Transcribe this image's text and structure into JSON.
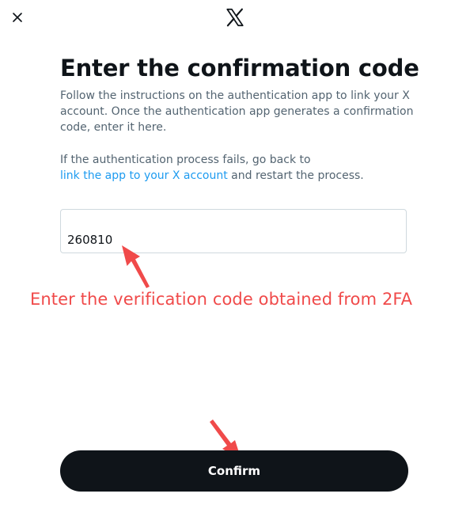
{
  "dialog": {
    "title": "Enter the confirmation code",
    "description": "Follow the instructions on the authentication app to link your X account. Once the authentication app generates a confirmation code, enter it here.",
    "fail_text_before": "If the authentication process fails, go back to",
    "fail_link_text": "link the app to your X account",
    "fail_text_after": "and restart the process.",
    "code_value": "260810",
    "confirm_label": "Confirm"
  },
  "annotations": {
    "code_hint": "Enter the verification code obtained from 2FA"
  },
  "colors": {
    "text_primary": "#0f1419",
    "text_secondary": "#536471",
    "link": "#1d9bf0",
    "annotation": "#f04a4a",
    "button_bg": "#0f1419"
  },
  "icons": {
    "close": "close-icon",
    "logo": "x-logo-icon",
    "arrow": "arrow-icon"
  }
}
